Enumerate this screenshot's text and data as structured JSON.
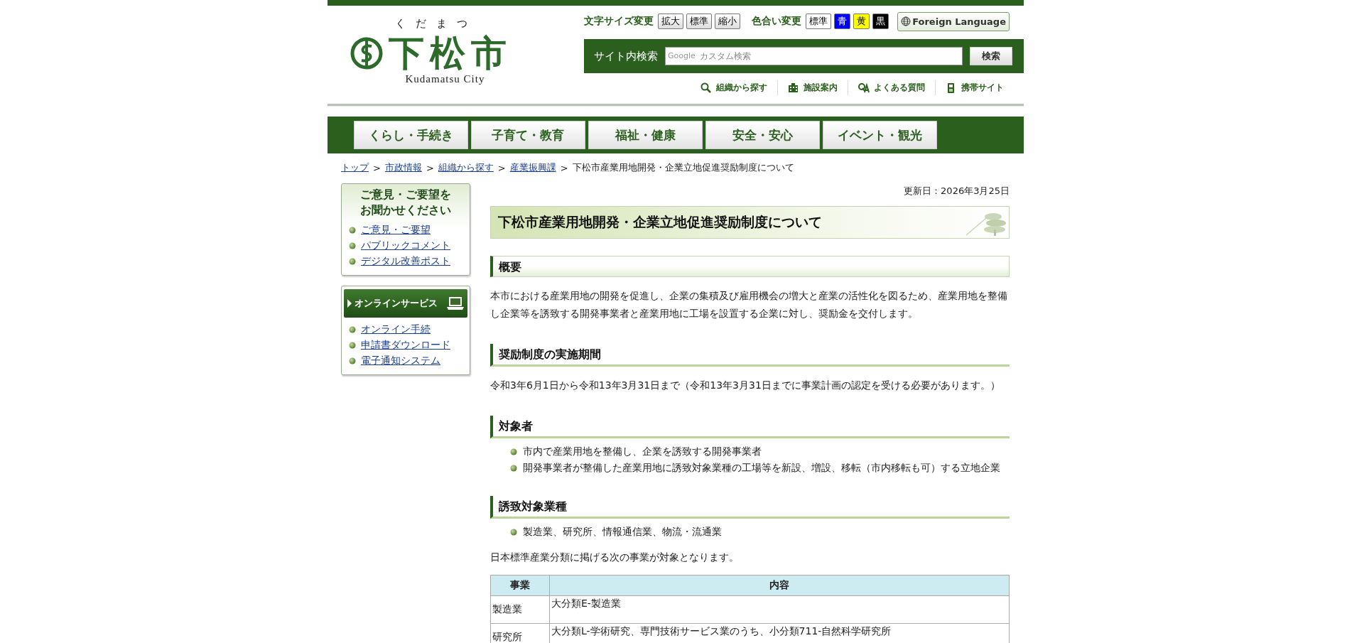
{
  "header": {
    "logo": {
      "reading": "くだまつ",
      "name": "下松市",
      "roman": "Kudamatsu City"
    },
    "text_size": {
      "label": "文字サイズ変更",
      "buttons": [
        {
          "label": "拡大"
        },
        {
          "label": "標準"
        },
        {
          "label": "縮小"
        }
      ]
    },
    "color_scheme": {
      "label": "色合い変更",
      "buttons": [
        {
          "label": "標準",
          "color": "#ffffff"
        },
        {
          "label": "青",
          "color": "#0000ff"
        },
        {
          "label": "黄",
          "color": "#ffff00"
        },
        {
          "label": "黒",
          "color": "#000000"
        }
      ]
    },
    "foreign_language": "Foreign Language",
    "search": {
      "label": "サイト内検索",
      "mark": "Google",
      "placeholder": "カスタム検索",
      "button": "検索"
    },
    "utility_links": [
      "組織から探す",
      "施設案内",
      "よくある質問",
      "携帯サイト"
    ]
  },
  "nav": [
    "くらし・手続き",
    "子育て・教育",
    "福祉・健康",
    "安全・安心",
    "イベント・観光"
  ],
  "breadcrumb_separator": ">",
  "breadcrumb": [
    {
      "label": "トップ",
      "kind": "link"
    },
    {
      "label": "市政情報",
      "kind": "link"
    },
    {
      "label": "組織から探す",
      "kind": "link"
    },
    {
      "label": "産業振興課",
      "kind": "link"
    },
    {
      "label": "下松市産業用地開発・企業立地促進奨励制度について",
      "kind": "current"
    }
  ],
  "sidebar": {
    "opinion": {
      "title_lines": [
        "ご意見・ご要望を",
        "お聞かせください"
      ],
      "links": [
        "ご意見・ご要望",
        "パブリックコメント",
        "デジタル改善ポスト"
      ]
    },
    "online": {
      "title": "オンラインサービス",
      "links": [
        "オンライン手続",
        "申請書ダウンロード",
        "電子通知システム"
      ]
    }
  },
  "main": {
    "updated": "更新日：2026年3月25日",
    "title": "下松市産業用地開発・企業立地促進奨励制度について",
    "sections": [
      {
        "heading": "概要",
        "kind": "boxed",
        "blocks": [
          {
            "kind": "paragraph",
            "text": "本市における産業用地の開発を促進し、企業の集積及び雇用機会の増大と産業の活性化を図るため、産業用地を整備し企業等を誘致する開発事業者と産業用地に工場を設置する企業に対し、奨励金を交付します。"
          }
        ]
      },
      {
        "heading": "奨励制度の実施期間",
        "kind": "underlined",
        "blocks": [
          {
            "kind": "paragraph",
            "text": "令和3年6月1日から令和13年3月31日まで（令和13年3月31日までに事業計画の認定を受ける必要があります。）"
          }
        ]
      },
      {
        "heading": "対象者",
        "kind": "underlined",
        "blocks": [
          {
            "kind": "list",
            "items": [
              "市内で産業用地を整備し、企業を誘致する開発事業者",
              "開発事業者が整備した産業用地に誘致対象業種の工場等を新設、増設、移転（市内移転も可）する立地企業"
            ]
          }
        ]
      },
      {
        "heading": "誘致対象業種",
        "kind": "underlined",
        "blocks": [
          {
            "kind": "list",
            "items": [
              "製造業、研究所、情報通信業、物流・流通業"
            ]
          },
          {
            "kind": "paragraph",
            "text": "日本標準産業分類に掲げる次の事業が対象となります。"
          },
          {
            "kind": "table",
            "columns": [
              "事業",
              "内容"
            ],
            "rows": [
              [
                "製造業",
                "大分類E-製造業"
              ],
              [
                "研究所",
                "大分類L-学術研究、専門技術サービス業のうち、小分類711-自然科学研究所"
              ]
            ]
          }
        ]
      }
    ]
  }
}
